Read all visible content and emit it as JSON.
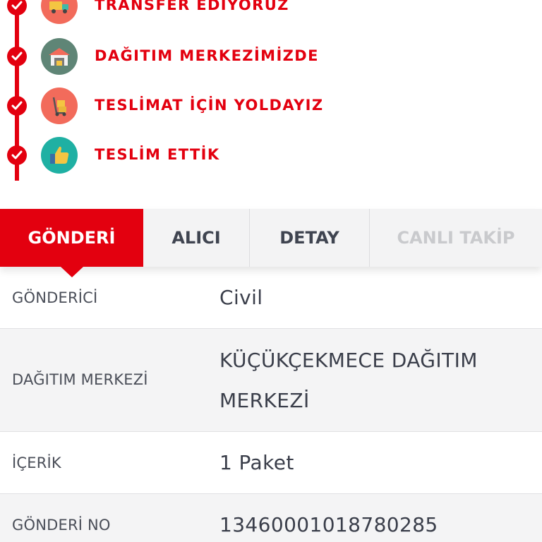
{
  "timeline": {
    "steps": [
      {
        "label": "TRANSFER EDİYORUZ",
        "icon": "truck-icon",
        "icon_color": "#f26b5b"
      },
      {
        "label": "DAĞITIM MERKEZİMİZDE",
        "icon": "warehouse-icon",
        "icon_color": "#5f8576"
      },
      {
        "label": "TESLİMAT İÇİN YOLDAYIZ",
        "icon": "hand-truck-icon",
        "icon_color": "#f26b5b"
      },
      {
        "label": "TESLİM ETTİK",
        "icon": "thumbs-up-icon",
        "icon_color": "#1fb0a3"
      }
    ],
    "accent_color": "#e3000f"
  },
  "tabs": [
    {
      "label": "GÖNDERİ",
      "state": "active"
    },
    {
      "label": "ALICI",
      "state": "normal"
    },
    {
      "label": "DETAY",
      "state": "normal"
    },
    {
      "label": "CANLI TAKİP",
      "state": "disabled"
    }
  ],
  "details": {
    "rows": [
      {
        "label": "GÖNDERİCİ",
        "value": "Civil"
      },
      {
        "label": "DAĞITIM MERKEZİ",
        "value": "KÜÇÜKÇEKMECE DAĞITIM MERKEZİ"
      },
      {
        "label": "İÇERİK",
        "value": "1 Paket"
      },
      {
        "label": "GÖNDERİ NO",
        "value": "13460001018780285"
      }
    ]
  }
}
